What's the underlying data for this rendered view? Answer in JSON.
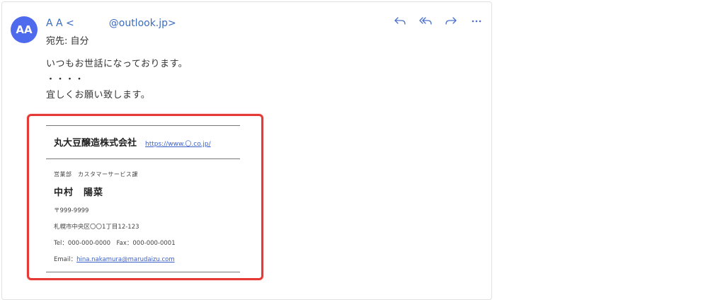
{
  "email": {
    "avatar_initials": "AA",
    "sender_name": "A A <",
    "sender_domain": "@outlook.jp>",
    "to_line": "宛先: 自分",
    "body_lines": [
      "いつもお世話になっております。",
      "・・・・",
      "宜しくお願い致します。"
    ]
  },
  "signature": {
    "company": "丸大豆醸造株式会社",
    "url": "https://www.〇.co.jp/",
    "department": "営業部　カスタマーサービス課",
    "name": "中村　陽菜",
    "postal": "〒999-9999",
    "address": "札幌市中央区〇〇1丁目12-123",
    "tel_fax": "Tel：000-000-0000　Fax：000-000-0001",
    "email_label": "Email：",
    "email_address": "hina.nakamura@marudaizu.com"
  },
  "colors": {
    "avatar": "#4f6bed",
    "highlight": "#e53935",
    "link": "#3a5fc8"
  },
  "icons": [
    "reply-icon",
    "reply-all-icon",
    "forward-icon",
    "more-icon"
  ]
}
